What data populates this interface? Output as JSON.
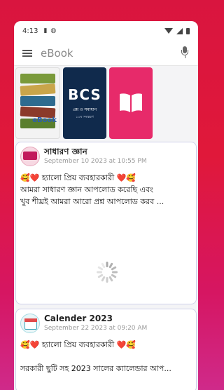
{
  "status_bar": {
    "time": "4:13",
    "icons": [
      "sd-card-icon",
      "android-icon",
      "wifi-icon",
      "signal-icon",
      "battery-icon"
    ]
  },
  "search": {
    "placeholder": "eBook"
  },
  "books": [
    {
      "label": "eBook",
      "icon": "book-stack-icon"
    },
    {
      "label": "BCS",
      "sub": "প্রশ্ন ও সমাধান",
      "sub2": "১০ম সংস্করণ"
    },
    {
      "icon": "open-book-icon"
    }
  ],
  "posts": [
    {
      "title": "সাধারণ জ্ঞান",
      "date": "September 10 2023 at 10:55 PM",
      "lines": [
        "🥰❤️ হ্যালো প্রিয় ব্যবহারকারী ❤️🥰",
        "আমরা সাধারণ জ্ঞান আপলোড করেছি এবং",
        "খুব শীঘ্রই আমরা আরো প্রশ্ন আপলোড করব ..."
      ],
      "loading": true
    },
    {
      "title": "Calender 2023",
      "date": "September 22 2023 at 09:20 AM",
      "lines": [
        "🥰❤️ হ্যালো প্রিয় ব্যবহারকারী ❤️🥰",
        "",
        "সরকারী ছুটি সহ 2023 সালের ক্যালেন্ডার আপ..."
      ]
    }
  ],
  "colors": {
    "background_top": "#d9153f",
    "background_bottom": "#cf2a8a",
    "card_border": "#cfd0ea",
    "date_text": "#9a9a9a"
  }
}
